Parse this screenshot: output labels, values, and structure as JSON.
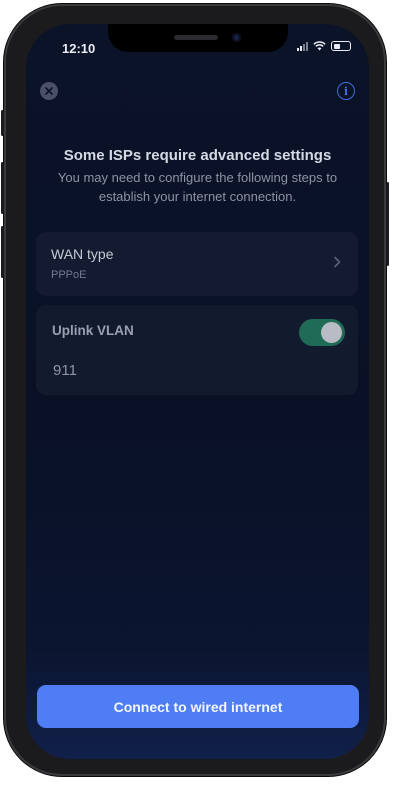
{
  "status_bar": {
    "time": "12:10"
  },
  "header": {
    "title": "Some ISPs require advanced settings",
    "subtitle": "You may need to configure the following steps to establish your internet connection."
  },
  "wan": {
    "label": "WAN type",
    "value": "PPPoE"
  },
  "vlan": {
    "label": "Uplink VLAN",
    "value": "911",
    "enabled": true
  },
  "actions": {
    "connect_label": "Connect to wired internet"
  },
  "colors": {
    "background": "#0a1126",
    "card": "#141b30",
    "accent": "#4f7df3",
    "toggle_on": "#1f6b55",
    "info": "#3f6ee0"
  },
  "icons": {
    "close": "close-icon",
    "info": "info-icon",
    "chevron": "chevron-right-icon",
    "signal": "signal-icon",
    "wifi": "wifi-icon",
    "battery": "battery-icon"
  }
}
